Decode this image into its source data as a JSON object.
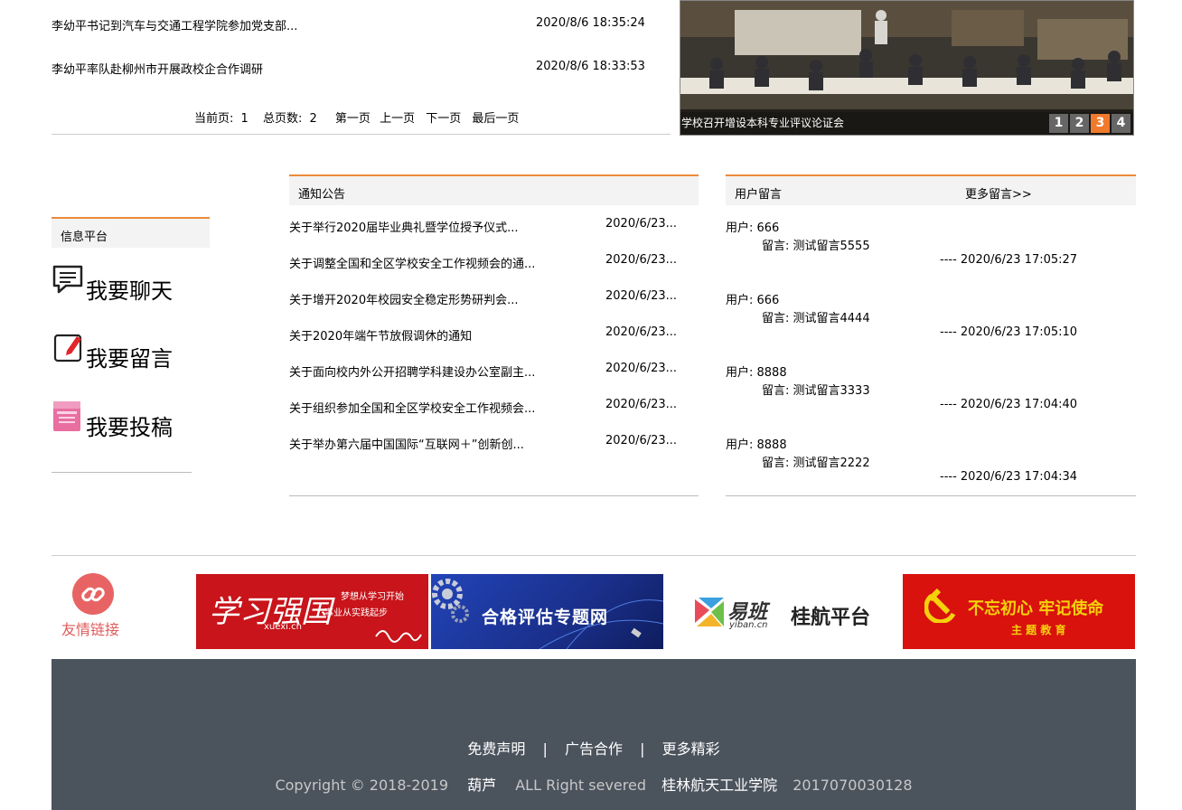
{
  "news": [
    {
      "title": "李幼平书记到汽车与交通工程学院参加党支部...",
      "date": "2020/8/6 18:35:24"
    },
    {
      "title": "李幼平率队赴柳州市开展政校企合作调研",
      "date": "2020/8/6 18:33:53"
    }
  ],
  "pager": {
    "current_label": "当前页:",
    "current": "1",
    "total_label": "总页数:",
    "total": "2",
    "first": "第一页",
    "prev": "上一页",
    "next": "下一页",
    "last": "最后一页"
  },
  "slider": {
    "caption": "学校召开增设本科专业评议论证会",
    "dots": [
      "1",
      "2",
      "3",
      "4"
    ],
    "active_index": 3
  },
  "platform": {
    "title": "信息平台",
    "items": [
      {
        "label": "我要聊天",
        "icon": "chat-icon"
      },
      {
        "label": "我要留言",
        "icon": "edit-icon"
      },
      {
        "label": "我要投稿",
        "icon": "submit-book-icon"
      }
    ]
  },
  "notices": {
    "title": "通知公告",
    "items": [
      {
        "title": "关于举行2020届毕业典礼暨学位授予仪式...",
        "date": "2020/6/23..."
      },
      {
        "title": "关于调整全国和全区学校安全工作视频会的通...",
        "date": "2020/6/23..."
      },
      {
        "title": "关于增开2020年校园安全稳定形势研判会...",
        "date": "2020/6/23..."
      },
      {
        "title": "关于2020年端午节放假调休的通知",
        "date": "2020/6/23..."
      },
      {
        "title": "关于面向校内外公开招聘学科建设办公室副主...",
        "date": "2020/6/23..."
      },
      {
        "title": "关于组织参加全国和全区学校安全工作视频会...",
        "date": "2020/6/23..."
      },
      {
        "title": "关于举办第六届中国国际“互联网＋”创新创...",
        "date": "2020/6/23..."
      }
    ]
  },
  "messages": {
    "title": "用户留言",
    "more": "更多留言>>",
    "items": [
      {
        "user": "用户: 666",
        "content": "留言: 测试留言5555",
        "date": "---- 2020/6/23 17:05:27"
      },
      {
        "user": "用户: 666",
        "content": "留言: 测试留言4444",
        "date": "---- 2020/6/23 17:05:10"
      },
      {
        "user": "用户: 8888",
        "content": "留言: 测试留言3333",
        "date": "---- 2020/6/23 17:04:40"
      },
      {
        "user": "用户: 8888",
        "content": "留言: 测试留言2222",
        "date": "---- 2020/6/23 17:04:34"
      }
    ]
  },
  "friend_links": {
    "label": "友情链接",
    "banners": [
      {
        "name": "xuexi",
        "big": "学习强国",
        "site": "xuexi.cn",
        "line1": "梦想从学习开始",
        "line2": "事业从实践起步",
        "bg": "#c8141a"
      },
      {
        "name": "assessment",
        "text": "合格评估专题网",
        "bg": "#1f3fa6"
      },
      {
        "name": "yiban",
        "brand": "易班",
        "site": "yiban.cn",
        "platform": "桂航平台",
        "bg": "#ffffff"
      },
      {
        "name": "party",
        "line1": "不忘初心 牢记使命",
        "line2": "主 题 教 育",
        "bg": "#d9120e"
      }
    ]
  },
  "footer": {
    "links": [
      "免费声明",
      "广告合作",
      "更多精彩"
    ],
    "separator": "|",
    "copyright": "Copyright © 2018-2019",
    "author": "葫芦",
    "rights": "ALL Right severed",
    "school": "桂林航天工业学院",
    "icp": "2017070030128"
  },
  "colors": {
    "accent": "#ea8a3a",
    "footer_bg": "#4b535d",
    "link_red": "#e05a5a"
  }
}
